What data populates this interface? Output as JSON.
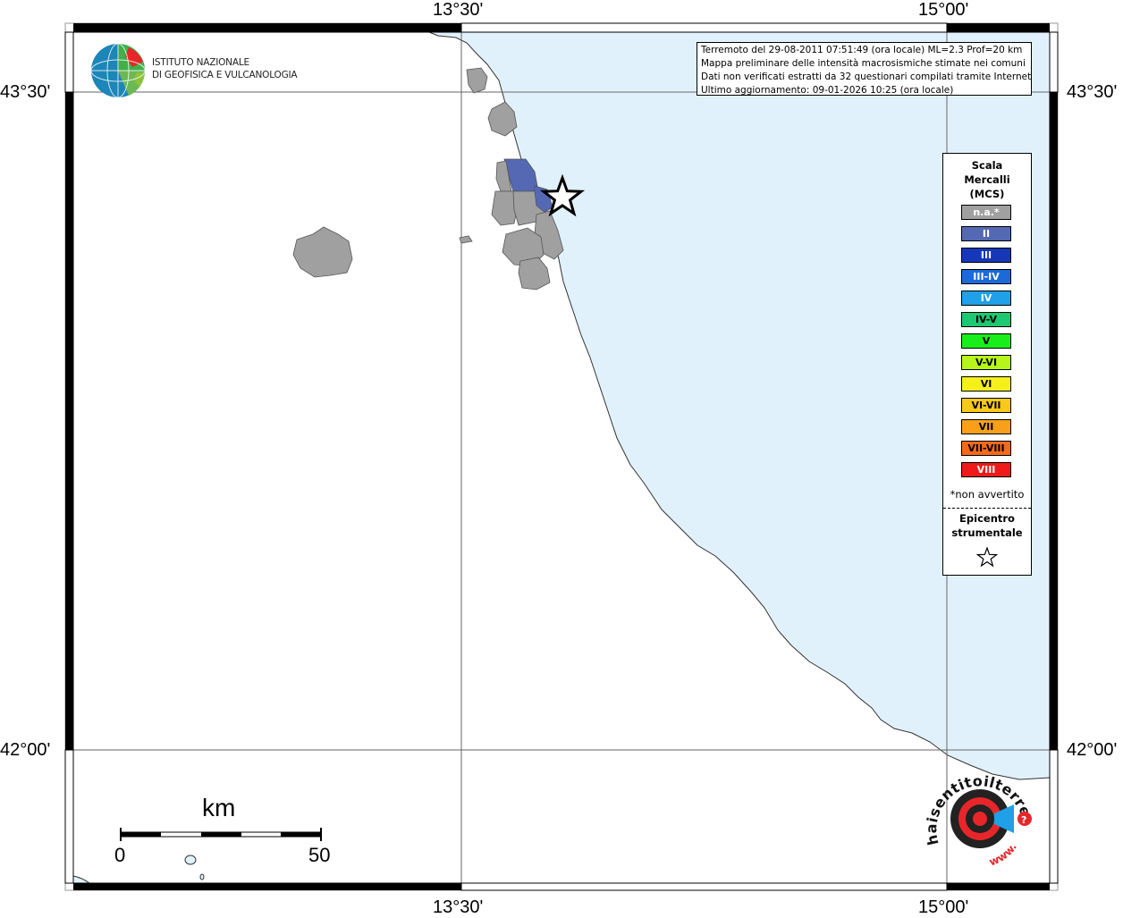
{
  "map": {
    "lon_labels": [
      "13°30'",
      "15°00'"
    ],
    "lat_labels": [
      "43°30'",
      "42°00'"
    ]
  },
  "info": {
    "line1": "Terremoto del 29-08-2011 07:51:49 (ora locale) ML=2.3 Prof=20 km",
    "line2": "Mappa preliminare delle intensità macrosismiche stimate nei comuni",
    "line3": "Dati non verificati estratti da 32 questionari compilati tramite Internet.",
    "line4": "Ultimo aggiornamento: 09-01-2026 10:25 (ora locale)"
  },
  "ingv": {
    "name_line1": "ISTITUTO NAZIONALE",
    "name_line2": "DI GEOFISICA E VULCANOLOGIA"
  },
  "legend": {
    "title_line1": "Scala",
    "title_line2": "Mercalli",
    "title_line3": "(MCS)",
    "classes": [
      {
        "label": "n.a.*",
        "color": "#a0a0a0",
        "text_color": "#ffffff"
      },
      {
        "label": "II",
        "color": "#5468b4",
        "text_color": "#ffffff"
      },
      {
        "label": "III",
        "color": "#1637b8",
        "text_color": "#ffffff"
      },
      {
        "label": "III-IV",
        "color": "#1b6ad8",
        "text_color": "#ffffff"
      },
      {
        "label": "IV",
        "color": "#1fa0e8",
        "text_color": "#ffffff"
      },
      {
        "label": "IV-V",
        "color": "#1ec870",
        "text_color": "#000000"
      },
      {
        "label": "V",
        "color": "#1aee1a",
        "text_color": "#000000"
      },
      {
        "label": "V-VI",
        "color": "#b6f51a",
        "text_color": "#000000"
      },
      {
        "label": "VI",
        "color": "#f6f01a",
        "text_color": "#000000"
      },
      {
        "label": "VI-VII",
        "color": "#f8c81a",
        "text_color": "#000000"
      },
      {
        "label": "VII",
        "color": "#f8a01a",
        "text_color": "#000000"
      },
      {
        "label": "VII-VIII",
        "color": "#f46a1a",
        "text_color": "#000000"
      },
      {
        "label": "VIII",
        "color": "#ee1a1a",
        "text_color": "#ffffff"
      }
    ],
    "note": "*non avvertito",
    "epicenter_line1": "Epicentro",
    "epicenter_line2": "strumentale"
  },
  "scale_bar": {
    "unit": "km",
    "min_label": "0",
    "max_label": "50"
  },
  "colors": {
    "sea": "#e1f1fc",
    "land": "#ffffff",
    "na_municipality": "#a0a0a0",
    "intensity_II": "#5468b4"
  },
  "hsit_logo": {
    "text": "haisentitoilterremoto.it",
    "url_text": "www."
  }
}
